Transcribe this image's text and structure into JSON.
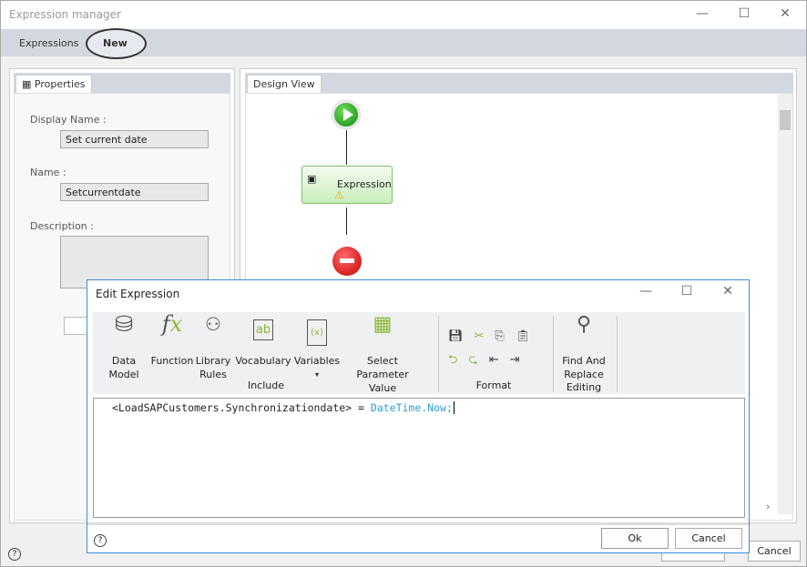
{
  "window": {
    "title": "Expression manager",
    "minimize": "—",
    "maximize": "☐",
    "close": "✕"
  },
  "main_tabs": [
    {
      "label": "Expressions"
    },
    {
      "label": "New",
      "active": true
    }
  ],
  "properties": {
    "tab": "Properties",
    "display_name_label": "Display Name :",
    "display_name": "Set current date",
    "name_label": "Name :",
    "name": "Setcurrentdate",
    "description_label": "Description :",
    "description": ""
  },
  "design_view": {
    "tab": "Design View",
    "node_label": "Expression"
  },
  "dialog": {
    "title": "Edit Expression",
    "minimize": "—",
    "maximize": "☐",
    "close": "✕",
    "ribbon": {
      "include": {
        "label": "Include",
        "items": [
          {
            "line1": "Data",
            "line2": "Model",
            "icon": "database-icon"
          },
          {
            "line1": "Function",
            "line2": "",
            "icon": "fx-icon"
          },
          {
            "line1": "Library",
            "line2": "Rules",
            "icon": "library-rules-icon"
          },
          {
            "line1": "Vocabulary",
            "line2": "",
            "icon": "vocabulary-icon"
          },
          {
            "line1": "Variables",
            "line2": "▾",
            "icon": "variables-icon"
          },
          {
            "line1": "Select Parameter",
            "line2": "Value",
            "icon": "select-parameter-icon"
          }
        ]
      },
      "format": {
        "label": "Format"
      },
      "editing": {
        "label": "Editing",
        "item": {
          "line1": "Find And",
          "line2": "Replace"
        }
      }
    },
    "expression": {
      "left": "<LoadSAPCustomers.Synchronizationdate>",
      "op": " = ",
      "right": "DateTime.Now;"
    },
    "ok": "Ok",
    "cancel": "Cancel",
    "help": "?"
  },
  "footer": {
    "cancel": "Cancel",
    "help": "?"
  },
  "colors": {
    "accent": "#3c8ddb",
    "keyword": "#2e9fd0",
    "green": "#8cb833"
  }
}
